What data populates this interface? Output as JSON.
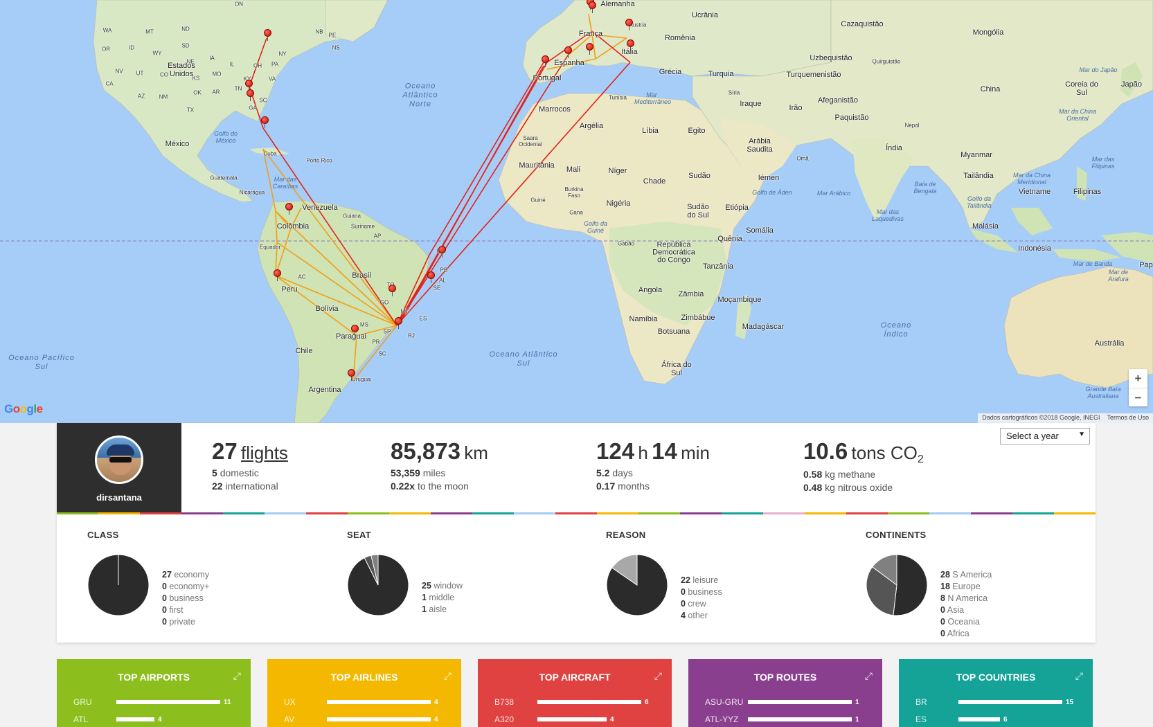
{
  "map": {
    "attribution": "Dados cartográficos ©2018 Google, INEGI",
    "terms": "Termos de Uso",
    "zoom_in": "+",
    "zoom_out": "−",
    "logo": "Google",
    "labels": {
      "canada_on": "ON",
      "wa": "WA",
      "mt": "MT",
      "nd": "ND",
      "or": "OR",
      "id": "ID",
      "sd": "SD",
      "wy": "WY",
      "ne": "NE",
      "nv": "NV",
      "ut": "UT",
      "co": "CO",
      "ks": "KS",
      "ca": "CA",
      "az": "AZ",
      "nm": "NM",
      "ok": "OK",
      "tx": "TX",
      "ia": "IA",
      "il": "IL",
      "mo": "MO",
      "ar": "AR",
      "tn": "TN",
      "ky": "KY",
      "oh": "OH",
      "pa": "PA",
      "ny": "NY",
      "nb": "NB",
      "pe": "PE",
      "ns": "NS",
      "va": "VA",
      "sc": "SC",
      "ga": "GA",
      "estados_unidos": "Estados Unidos",
      "mexico": "México",
      "golfo_mexico": "Golfo do México",
      "cuba": "Cuba",
      "porto_rico": "Porto Rico",
      "guatemala": "Guatemala",
      "nicaragua": "Nicarágua",
      "mar_caraibas": "Mar das Caraíbas",
      "venezuela": "Venezuela",
      "guiana": "Guiana",
      "suriname": "Suriname",
      "ap": "AP",
      "colombia": "Colômbia",
      "equador": "Equador",
      "peru": "Peru",
      "ac": "AC",
      "brasil": "Brasil",
      "bolivia": "Bolívia",
      "to": "TO",
      "go": "GO",
      "mg": "MG",
      "ms": "MS",
      "sp": "SP",
      "rj": "RJ",
      "es": "ES",
      "pr": "PR",
      "sc_br": "SC",
      "rn": "RN",
      "pb": "PB",
      "al": "AL",
      "se": "SE",
      "paraguai": "Paraguai",
      "uruguai": "Uruguai",
      "chile": "Chile",
      "argentina": "Argentina",
      "oceano_pacifico_sul": "Oceano Pacífico Sul",
      "oceano_atlantico_norte": "Oceano Atlântico Norte",
      "oceano_atlantico_sul": "Oceano Atlântico Sul",
      "oceano_indico": "Oceano Índico",
      "alemanha": "Alemanha",
      "ucrania": "Ucrânia",
      "cazaquistao": "Cazaquistão",
      "mongolia": "Mongólia",
      "franca": "França",
      "austria": "Áustria",
      "romenia": "Romênia",
      "espanha": "Espanha",
      "portugal": "Portugal",
      "italia": "Itália",
      "grecia": "Grécia",
      "turquia": "Turquia",
      "uzbequistao": "Uzbequistão",
      "quirguistao": "Quirguistão",
      "turquemenistao": "Turquemenistão",
      "mar_japao": "Mar do Japão",
      "coreia_sul": "Coreia do Sul",
      "japao": "Japão",
      "china": "China",
      "tunisia": "Tunísia",
      "mar_mediterraneo": "Mar Mediterrâneo",
      "siria": "Síria",
      "iraque": "Iraque",
      "ira": "Irão",
      "afeganistao": "Afeganistão",
      "paquistao": "Paquistão",
      "nepal": "Nepal",
      "mar_china_oriental": "Mar da China Oriental",
      "marrocos": "Marrocos",
      "argelia": "Argélia",
      "libia": "Líbia",
      "egito": "Egito",
      "arabia_saudita": "Arábia Saudita",
      "oma": "Omã",
      "india": "Índia",
      "myanmar": "Myanmar",
      "saara_ocidental": "Saara Ocidental",
      "mauritania": "Mauritânia",
      "mali": "Mali",
      "niger": "Níger",
      "chade": "Chade",
      "sudao": "Sudão",
      "iemen": "Iémen",
      "mar_filipinas": "Mar das Filipinas",
      "guine": "Guiné",
      "burkina_faso": "Burkina Faso",
      "nigeria": "Nigéria",
      "golfo_aden": "Golfo de Áden",
      "mar_arabico": "Mar Arábico",
      "baia_bengala": "Baía de Bengala",
      "tailandia": "Tailândia",
      "mar_china_meridional": "Mar da China Meridional",
      "vietname": "Vietname",
      "filipinas": "Filipinas",
      "gana": "Gana",
      "golfo_guine": "Golfo da Guiné",
      "sudao_sul": "Sudão do Sul",
      "etiopia": "Etiópia",
      "golfo_tailandia": "Golfo da Tailândia",
      "mar_laquedivas": "Mar das Laquedivas",
      "somalia": "Somália",
      "malasia": "Malásia",
      "gabao": "Gabão",
      "rd_congo": "República Democrática do Congo",
      "quenia": "Quênia",
      "indonesia": "Indonésia",
      "mar_banda": "Mar de Banda",
      "papua": "Pap",
      "tanzania": "Tanzânia",
      "mar_arafura": "Mar de Arafura",
      "angola": "Angola",
      "zambia": "Zâmbia",
      "mocambique": "Moçambique",
      "namibia": "Namíbia",
      "zimbabue": "Zimbábue",
      "madagascar": "Madagáscar",
      "botsuana": "Botsuana",
      "australia": "Austrália",
      "africa_do_sul": "África do Sul",
      "grande_baia": "Grande Baía Australiana"
    }
  },
  "summary": {
    "username": "dirsantana",
    "flights": {
      "count": "27",
      "unit": "flights",
      "domestic_n": "5",
      "domestic": "domestic",
      "intl_n": "22",
      "intl": "international"
    },
    "distance": {
      "count": "85,873",
      "unit": "km",
      "miles_n": "53,359",
      "miles": "miles",
      "moon_n": "0.22x",
      "moon": "to the moon"
    },
    "time": {
      "hours": "124",
      "h": "h",
      "minutes": "14",
      "min": "min",
      "days_n": "5.2",
      "days": "days",
      "months_n": "0.17",
      "months": "months"
    },
    "co2": {
      "count": "10.6",
      "unit": "tons CO",
      "sub": "2",
      "methane_n": "0.58",
      "methane": "kg methane",
      "nitrous_n": "0.48",
      "nitrous": "kg nitrous oxide"
    },
    "year_select": "Select a year"
  },
  "breakdown": {
    "class": {
      "title": "CLASS",
      "items": [
        {
          "n": "27",
          "label": "economy"
        },
        {
          "n": "0",
          "label": "economy+"
        },
        {
          "n": "0",
          "label": "business"
        },
        {
          "n": "0",
          "label": "first"
        },
        {
          "n": "0",
          "label": "private"
        }
      ]
    },
    "seat": {
      "title": "SEAT",
      "items": [
        {
          "n": "25",
          "label": "window"
        },
        {
          "n": "1",
          "label": "middle"
        },
        {
          "n": "1",
          "label": "aisle"
        }
      ]
    },
    "reason": {
      "title": "REASON",
      "items": [
        {
          "n": "22",
          "label": "leisure"
        },
        {
          "n": "0",
          "label": "business"
        },
        {
          "n": "0",
          "label": "crew"
        },
        {
          "n": "4",
          "label": "other"
        }
      ]
    },
    "continents": {
      "title": "CONTINENTS",
      "items": [
        {
          "n": "28",
          "label": "S America"
        },
        {
          "n": "18",
          "label": "Europe"
        },
        {
          "n": "8",
          "label": "N America"
        },
        {
          "n": "0",
          "label": "Asia"
        },
        {
          "n": "0",
          "label": "Oceania"
        },
        {
          "n": "0",
          "label": "Africa"
        }
      ]
    }
  },
  "pies": {
    "class": [
      27,
      0,
      0,
      0,
      0
    ],
    "seat": [
      25,
      1,
      1
    ],
    "reason": [
      22,
      0,
      0,
      4
    ],
    "continents": [
      28,
      18,
      8,
      0,
      0,
      0
    ],
    "shades": [
      "#2b2b2b",
      "#555555",
      "#808080",
      "#a8a8a8",
      "#c8c8c8",
      "#dddddd"
    ]
  },
  "tiles": [
    {
      "title": "TOP AIRPORTS",
      "color": "#8cbf1e",
      "rows": [
        {
          "label": "GRU",
          "value": "11",
          "frac": 1.0
        },
        {
          "label": "ATL",
          "value": "4",
          "frac": 0.364
        }
      ]
    },
    {
      "title": "TOP AIRLINES",
      "color": "#f5b800",
      "rows": [
        {
          "label": "UX",
          "value": "4",
          "frac": 1.0
        },
        {
          "label": "AV",
          "value": "4",
          "frac": 1.0
        }
      ]
    },
    {
      "title": "TOP AIRCRAFT",
      "color": "#e04141",
      "rows": [
        {
          "label": "B738",
          "value": "6",
          "frac": 1.0
        },
        {
          "label": "A320",
          "value": "4",
          "frac": 0.667
        }
      ]
    },
    {
      "title": "TOP ROUTES",
      "color": "#8a3f8e",
      "rows": [
        {
          "label": "ASU-GRU",
          "value": "1",
          "frac": 1.0
        },
        {
          "label": "ATL-YYZ",
          "value": "1",
          "frac": 1.0
        }
      ]
    },
    {
      "title": "TOP COUNTRIES",
      "color": "#14a396",
      "rows": [
        {
          "label": "BR",
          "value": "15",
          "frac": 1.0
        },
        {
          "label": "ES",
          "value": "6",
          "frac": 0.4
        }
      ]
    }
  ],
  "colors": {
    "rainbow": [
      "#8cbf1e",
      "#f5b800",
      "#e04141",
      "#8a3f8e",
      "#14a396",
      "#a6cdf8",
      "#e04141",
      "#8cbf1e",
      "#f5b800",
      "#8a3f8e",
      "#14a396",
      "#a6cdf8",
      "#e04141",
      "#f5b800",
      "#8cbf1e",
      "#8a3f8e",
      "#14a396",
      "#e8b0d0",
      "#f5b800",
      "#e04141",
      "#8cbf1e",
      "#a6cdf8",
      "#8a3f8e",
      "#14a396",
      "#f5b800"
    ]
  }
}
